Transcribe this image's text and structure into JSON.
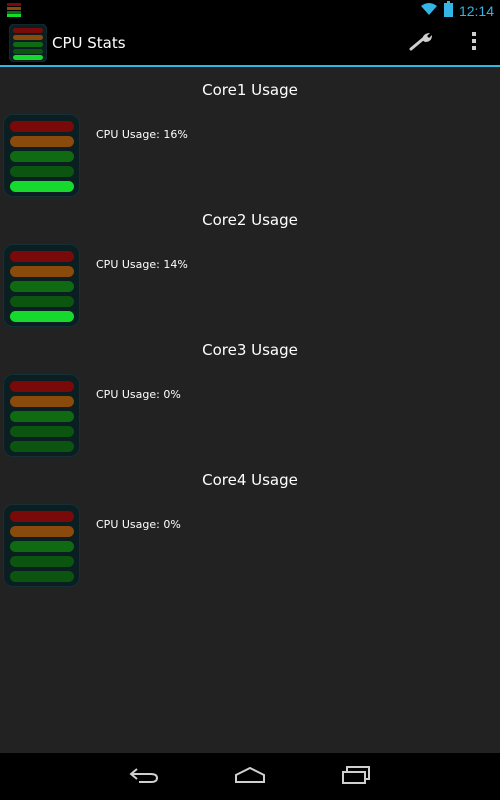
{
  "status_bar": {
    "time": "12:14",
    "icons": [
      "app-notification-icon",
      "wifi-icon",
      "battery-icon"
    ],
    "accent_color": "#33b5e5"
  },
  "action_bar": {
    "title": "CPU Stats",
    "icons": [
      "app-logo-icon",
      "wrench-icon",
      "overflow-menu-icon"
    ]
  },
  "cores": [
    {
      "title": "Core1 Usage",
      "usage": "CPU Usage: 16%",
      "active_bar": "bottom-bright"
    },
    {
      "title": "Core2 Usage",
      "usage": "CPU Usage: 14%",
      "active_bar": "bottom-bright"
    },
    {
      "title": "Core3 Usage",
      "usage": "CPU Usage: 0%",
      "active_bar": "none"
    },
    {
      "title": "Core4 Usage",
      "usage": "CPU Usage: 0%",
      "active_bar": "none"
    }
  ],
  "meter_colors": {
    "red": "#7a0a0a",
    "orange": "#8a4a0c",
    "green": "#0f6a12",
    "dark_green": "#0c5510",
    "bright_green": "#16d92d"
  },
  "nav_bar": {
    "icons": [
      "back-icon",
      "home-icon",
      "recent-apps-icon"
    ]
  }
}
